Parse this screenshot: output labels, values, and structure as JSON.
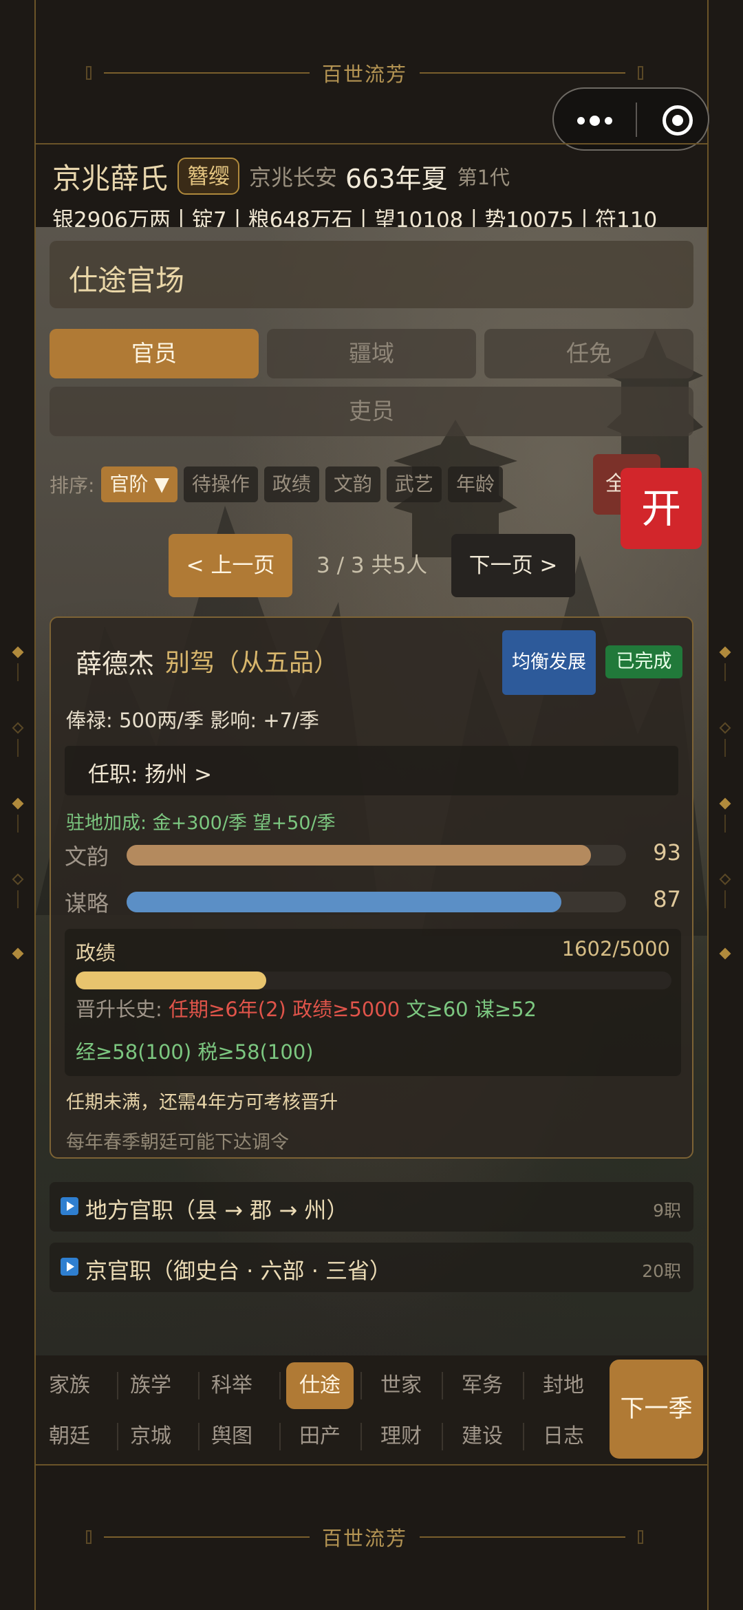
{
  "banner": {
    "motto_top": "百世流芳",
    "motto_bottom": "百世流芳"
  },
  "header": {
    "family_name": "京兆薛氏",
    "rank_badge": "簪缨",
    "region": "京兆长安",
    "year_season": "663年夏",
    "generation": "第1代",
    "resources": "银2906万两丨锭7丨粮648万石丨望10108丨势10075丨符110"
  },
  "panel": {
    "title": "仕途官场",
    "tabs": [
      "官员",
      "疆域",
      "任免",
      "吏员"
    ],
    "active_tab": "官员",
    "sort_label": "排序:",
    "sort_options": [
      "官阶 ▼",
      "待操作",
      "政绩",
      "文韵",
      "武艺",
      "年龄"
    ],
    "all_button": "全",
    "open_button": "开"
  },
  "pagination": {
    "prev": "< 上一页",
    "info": "3 / 3   共5人",
    "next": "下一页 >"
  },
  "official": {
    "name": "薛德杰",
    "title": "别驾（从五品）",
    "strategy_button": "均衡发展",
    "status_badge": "已完成",
    "salary": "俸禄: 500两/季    影响: +7/季",
    "post": "任职: 扬州  >",
    "post_bonus": "驻地加成: 金+300/季  望+50/季",
    "stats": [
      {
        "label": "文韵",
        "value": 93,
        "fraction": 0.93,
        "color": "#b48a5e"
      },
      {
        "label": "谋略",
        "value": 87,
        "fraction": 0.87,
        "color": "#5b8fc6"
      }
    ],
    "merit": {
      "label": "政绩",
      "value_text": "1602/5000",
      "fraction": 0.3204,
      "promotion_label": "晋升长史:",
      "req_tenure": "任期≥6年(2)",
      "req_merit": "政绩≥5000",
      "req_wen": "文≥60",
      "req_mou": "谋≥52",
      "req_jing": "经≥58(100)",
      "req_tax": "税≥58(100)"
    },
    "note_tenure": "任期未满，还需4年方可考核晋升",
    "note_edict": "每年春季朝廷可能下达调令"
  },
  "sections": [
    {
      "title": "地方官职（县 → 郡 → 州）",
      "count": "9职"
    },
    {
      "title": "京官职（御史台 · 六部 · 三省）",
      "count": "20职"
    }
  ],
  "bottom_nav": {
    "row1": [
      "家族",
      "族学",
      "科举",
      "仕途",
      "世家",
      "军务",
      "封地"
    ],
    "row2": [
      "朝廷",
      "京城",
      "舆图",
      "田产",
      "理财",
      "建设",
      "日志"
    ],
    "active": "仕途",
    "next_season": "下一季"
  },
  "colors": {
    "accent": "#b07a35",
    "gold_text": "#d8b66c",
    "danger": "#d2262b",
    "success": "#21793a",
    "info": "#2d5a9a"
  },
  "icons": {
    "menu": "more-dots-icon",
    "close": "target-circle-icon",
    "section": "play-square-icon"
  }
}
